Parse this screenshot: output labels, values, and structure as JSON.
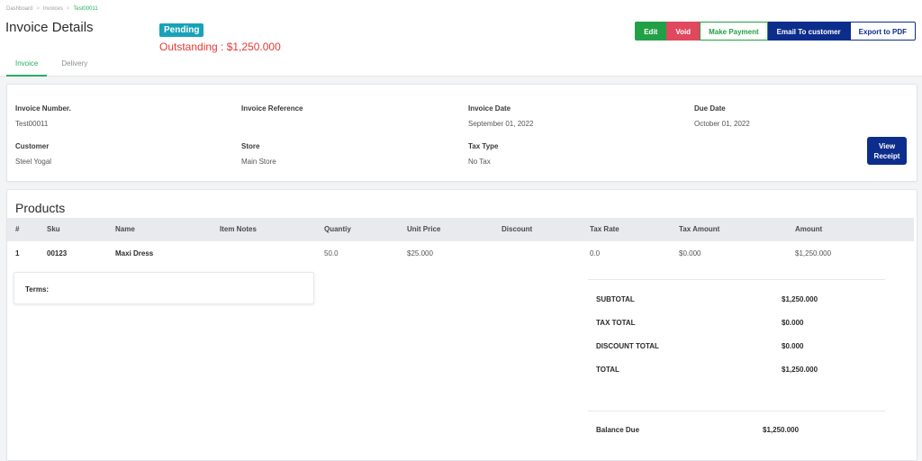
{
  "breadcrumb": [
    "Dashboard",
    "Invoices",
    "Test00011"
  ],
  "title": "Invoice Details",
  "status": "Pending",
  "outstanding": "Outstanding : $1,250.000",
  "actions": {
    "edit": "Edit",
    "void": "Void",
    "make_payment": "Make Payment",
    "email": "Email To customer",
    "export_pdf": "Export to PDF"
  },
  "tabs": [
    "Invoice",
    "Delivery"
  ],
  "info": {
    "invoice_number_label": "Invoice Number.",
    "invoice_number": "Test00011",
    "invoice_reference_label": "Invoice Reference",
    "invoice_reference": "",
    "invoice_date_label": "Invoice Date",
    "invoice_date": "September 01, 2022",
    "due_date_label": "Due Date",
    "due_date": "October 01, 2022",
    "customer_label": "Customer",
    "customer": "Steel Yogal",
    "store_label": "Store",
    "store": "Main Store",
    "tax_type_label": "Tax Type",
    "tax_type": "No Tax",
    "view_receipt": "View Receipt"
  },
  "products": {
    "title": "Products",
    "columns": {
      "num": "#",
      "sku": "Sku",
      "name": "Name",
      "notes": "Item Notes",
      "qty": "Quantiy",
      "unit_price": "Unit Price",
      "discount": "Discount",
      "tax_rate": "Tax Rate",
      "tax_amount": "Tax Amount",
      "amount": "Amount"
    },
    "rows": [
      {
        "num": "1",
        "sku": "00123",
        "name": "Maxi Dress",
        "notes": "",
        "qty": "50.0",
        "unit_price": "$25.000",
        "discount": "",
        "tax_rate": "0.0",
        "tax_amount": "$0.000",
        "amount": "$1,250.000"
      }
    ]
  },
  "terms_label": "Terms:",
  "totals": {
    "subtotal_label": "SUBTOTAL",
    "subtotal": "$1,250.000",
    "tax_total_label": "TAX TOTAL",
    "tax_total": "$0.000",
    "discount_total_label": "DISCOUNT TOTAL",
    "discount_total": "$0.000",
    "total_label": "TOTAL",
    "total": "$1,250.000",
    "balance_due_label": "Balance Due",
    "balance_due": "$1,250.000"
  }
}
